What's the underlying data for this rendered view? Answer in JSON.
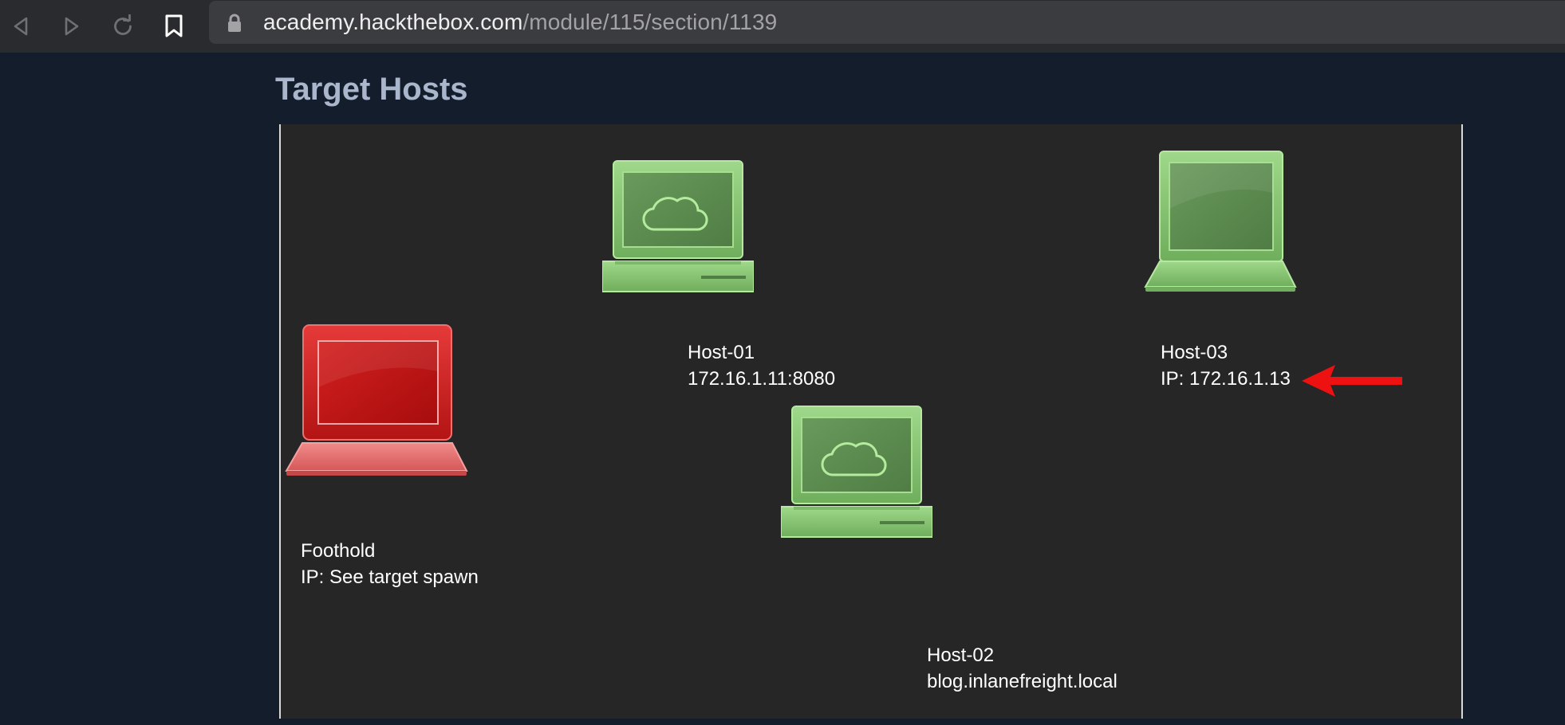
{
  "browser": {
    "url_host": "academy.hackthebox.com",
    "url_path": "/module/115/section/1139",
    "icons": [
      "back-icon",
      "forward-icon",
      "reload-icon",
      "bookmark-icon",
      "lock-icon"
    ]
  },
  "page": {
    "title": "Target Hosts"
  },
  "diagram": {
    "foothold": {
      "name": "Foothold",
      "ip": "IP: See target spawn",
      "color": "#d42020"
    },
    "host01": {
      "name": "Host-01",
      "ip": "172.16.1.11:8080",
      "color": "#86c46e"
    },
    "host02": {
      "name": "Host-02",
      "ip": "blog.inlanefreight.local",
      "color": "#86c46e"
    },
    "host03": {
      "name": "Host-03",
      "ip": "IP: 172.16.1.13",
      "color": "#86c46e"
    },
    "annotation": {
      "arrow_color": "#ee1111"
    }
  }
}
